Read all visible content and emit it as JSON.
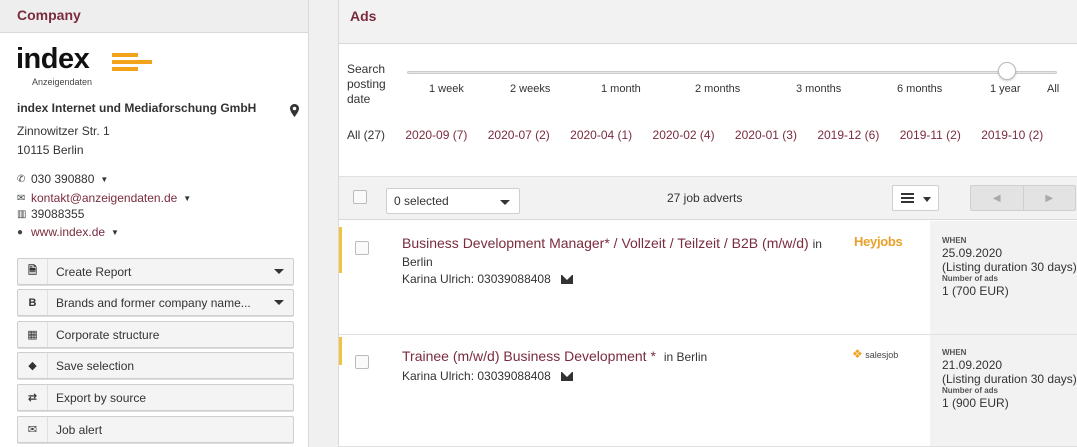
{
  "left": {
    "header": "Company",
    "logo": {
      "word": "index",
      "sub": "Anzeigendaten"
    },
    "company_name": "index Internet und Mediaforschung GmbH",
    "address_line1": "Zinnowitzer Str. 1",
    "address_line2": "10115 Berlin",
    "phone": "030 390880",
    "email": "kontakt@anzeigendaten.de",
    "fax": "39088355",
    "website": "www.index.de",
    "actions": [
      {
        "label": "Create Report",
        "icon": "B",
        "has_caret": true
      },
      {
        "label": "Brands and former company name...",
        "icon": "B",
        "has_caret": true
      },
      {
        "label": "Corporate structure",
        "icon": "▤",
        "has_caret": false
      },
      {
        "label": "Save selection",
        "icon": "🏷",
        "has_caret": false
      },
      {
        "label": "Export by source",
        "icon": "⇄",
        "has_caret": false
      },
      {
        "label": "Job alert",
        "icon": "✉",
        "has_caret": false
      }
    ]
  },
  "main": {
    "header": "Ads",
    "slider": {
      "label": "Search posting date",
      "ticks": [
        "1 week",
        "2 weeks",
        "1 month",
        "2 months",
        "3 months",
        "6 months",
        "1 year",
        "All"
      ],
      "selected": "1 year"
    },
    "months": [
      "All (27)",
      "2020-09 (7)",
      "2020-07 (2)",
      "2020-04 (1)",
      "2020-02 (4)",
      "2020-01 (3)",
      "2019-12 (6)",
      "2019-11 (2)",
      "2019-10 (2)"
    ],
    "toolbar": {
      "selected_label": "0 selected",
      "count_label": "27 job adverts",
      "prev": "◀",
      "next": "▶"
    },
    "ads": [
      {
        "title": "Business Development Manager* / Vollzeit / Teilzeit / B2B (m/w/d)",
        "location": "in Berlin",
        "contact": "Karina Ulrich: 03039088408",
        "source_logo": "Heyjobs",
        "when_label": "WHEN",
        "date": "25.09.2020",
        "duration": "(Listing duration 30 days)",
        "num_label": "Number of ads",
        "num_value": "1 (700 EUR)"
      },
      {
        "title": "Trainee (m/w/d) Business Development",
        "title_star": "*",
        "location": "in Berlin",
        "contact": "Karina Ulrich: 03039088408",
        "source_logo": "salesjob",
        "when_label": "WHEN",
        "date": "21.09.2020",
        "duration": "(Listing duration 30 days)",
        "num_label": "Number of ads",
        "num_value": "1 (900 EUR)"
      }
    ]
  },
  "colors": {
    "accent": "#7a2c3e",
    "logo_orange": "#f3a21b",
    "stripe": "#f3c33b"
  }
}
